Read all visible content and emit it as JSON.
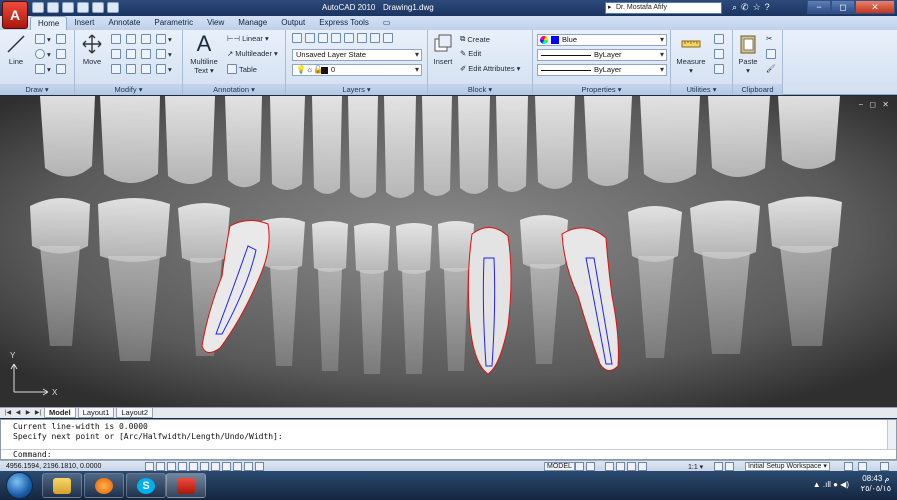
{
  "titlebar": {
    "app_title": "AutoCAD 2010",
    "file_name": "Drawing1.dwg",
    "user": "Dr. Mostafa Afify",
    "app_letter": "A"
  },
  "tabs": [
    "Home",
    "Insert",
    "Annotate",
    "Parametric",
    "View",
    "Manage",
    "Output",
    "Express Tools"
  ],
  "ribbon": {
    "draw": {
      "label": "Draw ▾",
      "line": "Line"
    },
    "modify": {
      "label": "Modify ▾",
      "move": "Move"
    },
    "annotation": {
      "label": "Annotation ▾",
      "multiline_text": "Multiline",
      "multiline_text2": "Text",
      "linear": "Linear",
      "multileader": "Multileader",
      "table": "Table"
    },
    "layers": {
      "label": "Layers ▾",
      "layer_state": "Unsaved Layer State",
      "current_layer": "0"
    },
    "block": {
      "label": "Block ▾",
      "insert": "Insert",
      "create": "Create",
      "edit": "Edit",
      "edit_attributes": "Edit Attributes"
    },
    "properties": {
      "label": "Properties ▾",
      "color": "Blue",
      "lineweight": "ByLayer",
      "linetype": "ByLayer"
    },
    "utilities": {
      "label": "Utilities ▾",
      "measure": "Measure"
    },
    "clipboard": {
      "label": "Clipboard",
      "paste": "Paste"
    }
  },
  "drawing": {
    "viewport_controls": "− ◻ ✕",
    "ucs_x": "X",
    "ucs_y": "Y"
  },
  "layout_tabs": [
    "Model",
    "Layout1",
    "Layout2"
  ],
  "command": {
    "line1": "Current line-width is 0.0000",
    "line2": "Specify next point or [Arc/Halfwidth/Length/Undo/Width]:",
    "prompt": "Command:"
  },
  "status": {
    "coords": "4956.1594, 2196.1810, 0.0000",
    "model": "MODEL",
    "scale": "1:1 ▾",
    "workspace": "Initial Setup Workspace ▾"
  },
  "taskbar": {
    "clock_time": "08:43 م",
    "clock_date": "٢٥/٠٥/١٥",
    "tray": "▲ .ıll ● ◀)"
  },
  "colors": {
    "outline_red": "#e01010",
    "canal_blue": "#2020ff",
    "layer_blue": "#0000ff"
  }
}
